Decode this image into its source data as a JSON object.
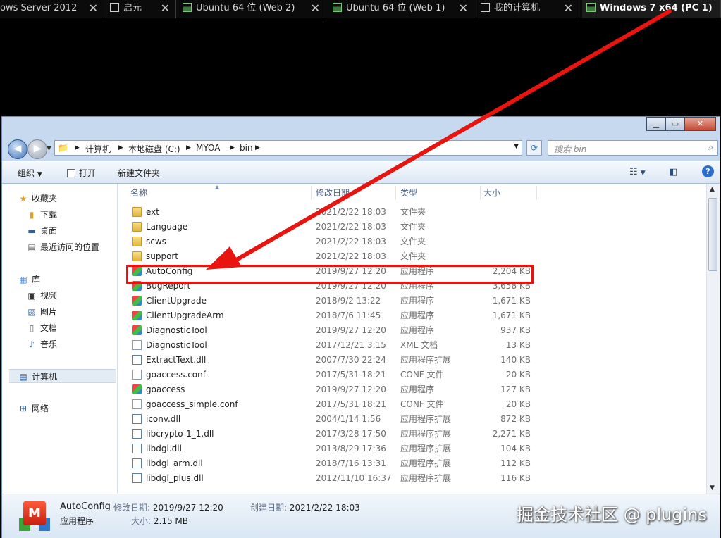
{
  "vm_tabs": [
    {
      "label": "ows Server 2012",
      "kind": "vm"
    },
    {
      "label": "启元",
      "kind": "page"
    },
    {
      "label": "Ubuntu 64 位 (Web 2)",
      "kind": "vm"
    },
    {
      "label": "Ubuntu 64 位 (Web 1)",
      "kind": "vm"
    },
    {
      "label": "我的计算机",
      "kind": "computer"
    },
    {
      "label": "Windows 7 x64 (PC 1)",
      "kind": "vm",
      "active": true
    }
  ],
  "address": {
    "segments": [
      "计算机",
      "本地磁盘 (C:)",
      "MYOA",
      "bin"
    ]
  },
  "search": {
    "placeholder": "搜索 bin"
  },
  "toolbar": {
    "organize": "组织",
    "open": "打开",
    "new_folder": "新建文件夹"
  },
  "nav": {
    "favorites": "收藏夹",
    "downloads": "下载",
    "desktop": "桌面",
    "recent": "最近访问的位置",
    "libraries": "库",
    "videos": "视频",
    "pictures": "图片",
    "documents": "文档",
    "music": "音乐",
    "computer": "计算机",
    "network": "网络"
  },
  "columns": {
    "name": "名称",
    "modified": "修改日期",
    "type": "类型",
    "size": "大小"
  },
  "files": [
    {
      "name": "ext",
      "date": "2021/2/22 18:03",
      "type": "文件夹",
      "size": "",
      "icon": "folder"
    },
    {
      "name": "Language",
      "date": "2021/2/22 18:03",
      "type": "文件夹",
      "size": "",
      "icon": "folder"
    },
    {
      "name": "scws",
      "date": "2021/2/22 18:03",
      "type": "文件夹",
      "size": "",
      "icon": "folder"
    },
    {
      "name": "support",
      "date": "2021/2/22 18:03",
      "type": "文件夹",
      "size": "",
      "icon": "folder"
    },
    {
      "name": "AutoConfig",
      "date": "2019/9/27 12:20",
      "type": "应用程序",
      "size": "2,204 KB",
      "icon": "exe",
      "highlighted": true
    },
    {
      "name": "BugReport",
      "date": "2019/9/27 12:20",
      "type": "应用程序",
      "size": "3,658 KB",
      "icon": "exe"
    },
    {
      "name": "ClientUpgrade",
      "date": "2018/9/2 13:22",
      "type": "应用程序",
      "size": "1,671 KB",
      "icon": "exe"
    },
    {
      "name": "ClientUpgradeArm",
      "date": "2018/7/6 11:45",
      "type": "应用程序",
      "size": "1,671 KB",
      "icon": "exe"
    },
    {
      "name": "DiagnosticTool",
      "date": "2019/9/27 12:20",
      "type": "应用程序",
      "size": "937 KB",
      "icon": "exe"
    },
    {
      "name": "DiagnosticTool",
      "date": "2017/12/21 3:15",
      "type": "XML 文档",
      "size": "13 KB",
      "icon": "doc"
    },
    {
      "name": "ExtractText.dll",
      "date": "2007/7/30 22:24",
      "type": "应用程序扩展",
      "size": "140 KB",
      "icon": "dll"
    },
    {
      "name": "goaccess.conf",
      "date": "2017/5/31 18:21",
      "type": "CONF 文件",
      "size": "20 KB",
      "icon": "doc"
    },
    {
      "name": "goaccess",
      "date": "2019/9/27 12:20",
      "type": "应用程序",
      "size": "127 KB",
      "icon": "exe"
    },
    {
      "name": "goaccess_simple.conf",
      "date": "2017/5/31 18:21",
      "type": "CONF 文件",
      "size": "20 KB",
      "icon": "doc"
    },
    {
      "name": "iconv.dll",
      "date": "2004/1/14 1:56",
      "type": "应用程序扩展",
      "size": "872 KB",
      "icon": "dll"
    },
    {
      "name": "libcrypto-1_1.dll",
      "date": "2017/3/28 17:50",
      "type": "应用程序扩展",
      "size": "2,271 KB",
      "icon": "dll"
    },
    {
      "name": "libdgl.dll",
      "date": "2013/8/29 17:36",
      "type": "应用程序扩展",
      "size": "104 KB",
      "icon": "dll"
    },
    {
      "name": "libdgl_arm.dll",
      "date": "2018/7/16 13:31",
      "type": "应用程序扩展",
      "size": "112 KB",
      "icon": "dll"
    },
    {
      "name": "libdgl_plus.dll",
      "date": "2012/11/10 16:37",
      "type": "应用程序扩展",
      "size": "116 KB",
      "icon": "dll"
    }
  ],
  "details": {
    "name": "AutoConfig",
    "modified_label": "修改日期:",
    "modified": "2019/9/27 12:20",
    "created_label": "创建日期:",
    "created": "2021/2/22 18:03",
    "type": "应用程序",
    "size_label": "大小:",
    "size": "2.15 MB"
  },
  "watermark": "掘金技术社区 @ plugins",
  "colors": {
    "annotation_red": "#e8140f",
    "window_chrome": "#c7d9ee"
  }
}
